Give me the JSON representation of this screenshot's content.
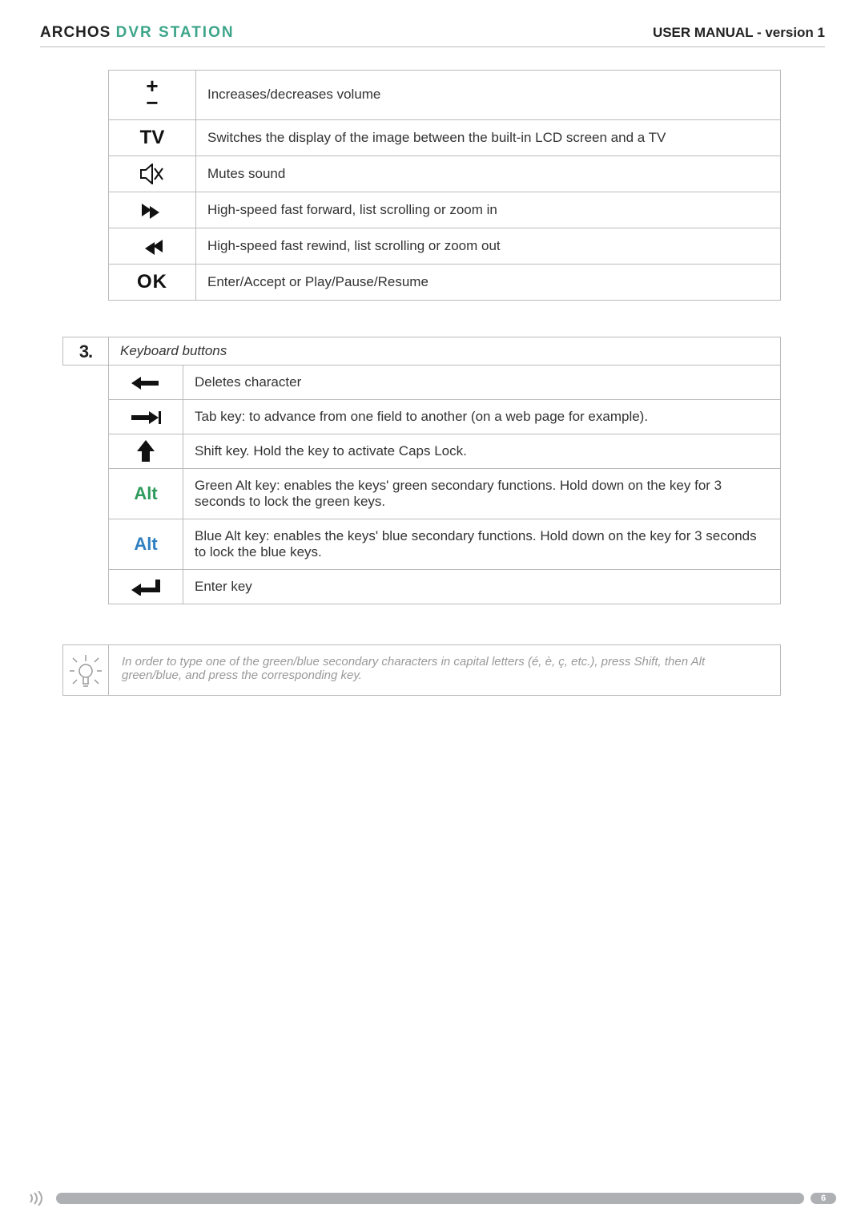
{
  "header": {
    "brand_archos": "ARCHOS",
    "brand_dvr": "DVR STATION",
    "manual_title": "USER MANUAL - version 1"
  },
  "functions": [
    {
      "icon": "plus-minus",
      "label": "+/−",
      "desc": "Increases/decreases volume"
    },
    {
      "icon": "tv",
      "label": "TV",
      "desc": "Switches the display of the image between the built-in LCD screen and a TV"
    },
    {
      "icon": "mute",
      "label": "mute",
      "desc": "Mutes sound"
    },
    {
      "icon": "ffwd",
      "label": "ffwd",
      "desc": "High-speed fast forward, list scrolling or zoom in"
    },
    {
      "icon": "rew",
      "label": "rew",
      "desc": "High-speed fast rewind, list scrolling or zoom out"
    },
    {
      "icon": "ok",
      "label": "OK",
      "desc": "Enter/Accept or Play/Pause/Resume"
    }
  ],
  "section": {
    "number": "3.",
    "title": "Keyboard buttons"
  },
  "keyboard": [
    {
      "icon": "backspace",
      "desc": "Deletes character"
    },
    {
      "icon": "tab",
      "desc": "Tab key: to advance from one field to another (on a web page for example)."
    },
    {
      "icon": "shift",
      "desc": "Shift key. Hold the key to activate Caps Lock."
    },
    {
      "icon": "alt-green",
      "label": "Alt",
      "desc": "Green Alt key: enables the keys' green secondary functions. Hold down on the key for 3 seconds to lock the green keys."
    },
    {
      "icon": "alt-blue",
      "label": "Alt",
      "desc": "Blue Alt key: enables the keys' blue secondary functions. Hold down on the key for 3 seconds to lock the blue keys."
    },
    {
      "icon": "enter",
      "desc": "Enter key"
    }
  ],
  "tip": {
    "text": "In order to type one of the green/blue secondary characters in capital letters (é, è, ç, etc.), press Shift, then Alt green/blue, and press the corresponding key."
  },
  "footer": {
    "page_number": "6"
  }
}
